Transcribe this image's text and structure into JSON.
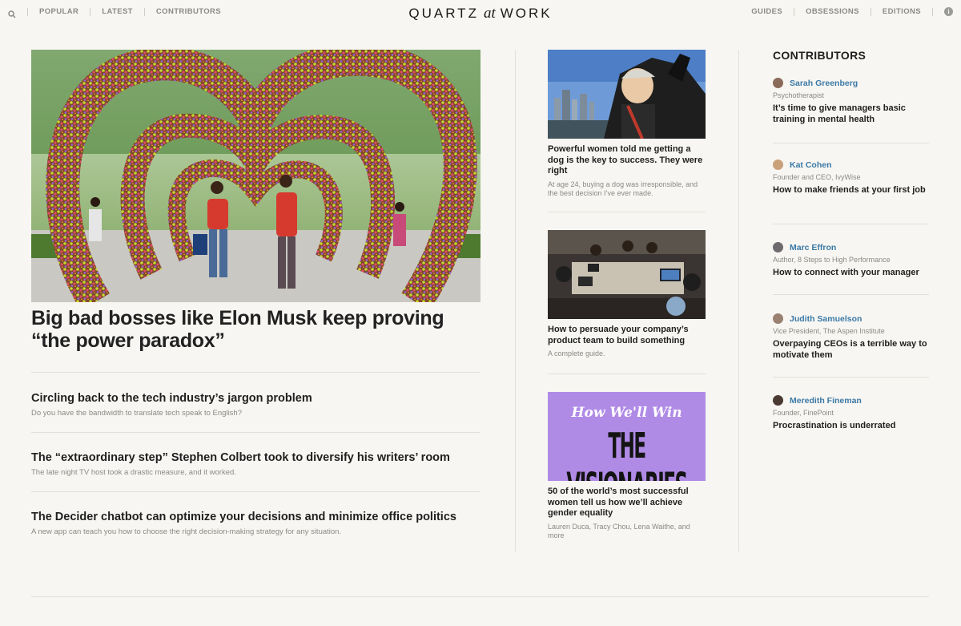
{
  "nav": {
    "left": [
      "POPULAR",
      "LATEST",
      "CONTRIBUTORS"
    ],
    "right": [
      "GUIDES",
      "OBSESSIONS",
      "EDITIONS"
    ],
    "logo_main": "QUARTZ",
    "logo_at": "at",
    "logo_end": "WORK",
    "search_icon": "search-icon",
    "info_icon": "info-icon"
  },
  "hero": {
    "title": "Big bad bosses like Elon Musk keep proving “the power paradox”"
  },
  "stories": [
    {
      "title": "Circling back to the tech industry’s jargon problem",
      "desc": "Do you have the bandwidth to translate tech speak to English?"
    },
    {
      "title": "The “extraordinary step” Stephen Colbert took to diversify his writers’ room",
      "desc": "The late night TV host took a drastic measure, and it worked."
    },
    {
      "title": "The Decider chatbot can optimize your decisions and minimize office politics",
      "desc": "A new app can teach you how to choose the right decision-making strategy for any situation."
    }
  ],
  "middle": [
    {
      "title": "Powerful women told me getting a dog is the key to success. They were right",
      "desc": "At age 24, buying a dog was irresponsible, and the best decision I’ve ever made."
    },
    {
      "title": "How to persuade your company’s product team to build something",
      "desc": "A complete guide."
    },
    {
      "title": "50 of the world’s most successful women tell us how we’ll achieve gender equality",
      "desc": "Lauren Duca, Tracy Chou, Lena Waithe, and more",
      "art_script": "How We'll Win",
      "art_block": "THE VISIONARIES"
    }
  ],
  "contributors_heading": "CONTRIBUTORS",
  "contributors": [
    {
      "name": "Sarah Greenberg",
      "role": "Psychotherapist",
      "title": "It’s time to give managers basic training in mental health"
    },
    {
      "name": "Kat Cohen",
      "role": "Founder and CEO, IvyWise",
      "title": "How to make friends at your first job"
    },
    {
      "name": "Marc Effron",
      "role": "Author, 8 Steps to High Performance",
      "title": "How to connect with your manager"
    },
    {
      "name": "Judith Samuelson",
      "role": "Vice President, The Aspen Institute",
      "title": "Overpaying CEOs is a terrible way to motivate them"
    },
    {
      "name": "Meredith Fineman",
      "role": "Founder, FinePoint",
      "title": "Procrastination is underrated"
    }
  ],
  "colors": {
    "link": "#3b79a6",
    "background": "#f7f6f2",
    "art_purple": "#b08be6"
  }
}
